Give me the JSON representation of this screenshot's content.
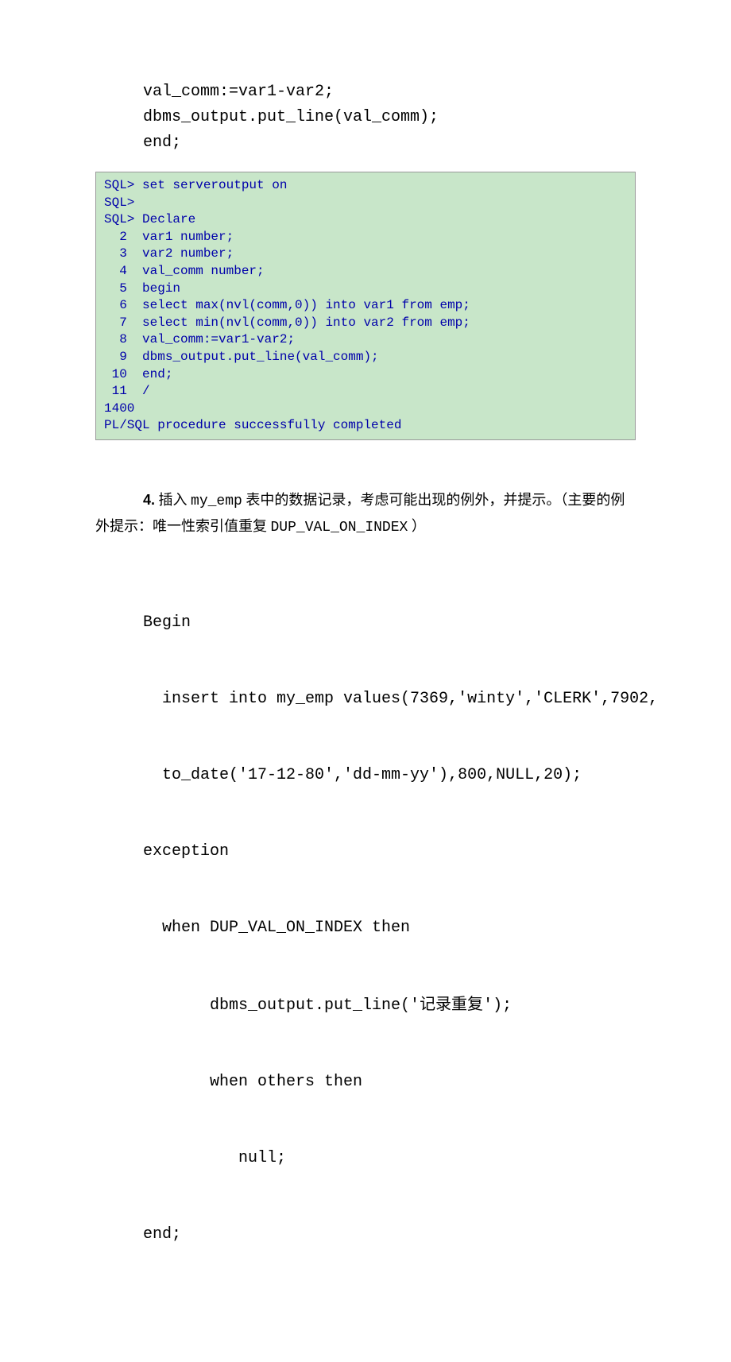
{
  "top_code": {
    "l1": "val_comm:=var1-var2;",
    "l2": "dbms_output.put_line(val_comm);",
    "l3": "end;"
  },
  "sql_block": [
    "SQL> set serveroutput on",
    "SQL>",
    "SQL> Declare",
    "  2  var1 number;",
    "  3  var2 number;",
    "  4  val_comm number;",
    "  5  begin",
    "  6  select max(nvl(comm,0)) into var1 from emp;",
    "  7  select min(nvl(comm,0)) into var2 from emp;",
    "  8  val_comm:=var1-var2;",
    "  9  dbms_output.put_line(val_comm);",
    " 10  end;",
    " 11  /",
    "1400",
    "PL/SQL procedure successfully completed"
  ],
  "question": {
    "num": "4.",
    "text_pre": " 插入 ",
    "mono1": "my_emp",
    "text_mid": " 表中的数据记录，考虑可能出现的例外，并提示。（主要的例外提示：唯一性索引值重复 ",
    "mono2": "DUP_VAL_ON_INDEX",
    "text_post": " ）"
  },
  "bottom_code": {
    "l1": "Begin",
    "l2": "  insert into my_emp values(7369,'winty','CLERK',7902,",
    "l3": "  to_date('17-12-80','dd-mm-yy'),800,NULL,20);",
    "l4": "exception",
    "l5": "  when DUP_VAL_ON_INDEX then",
    "l6_pre": "       dbms_output.put_line('",
    "l6_cn": "记录重复",
    "l6_post": "');",
    "l7": "       when others then",
    "l8": "          null;",
    "l9": "end;"
  }
}
